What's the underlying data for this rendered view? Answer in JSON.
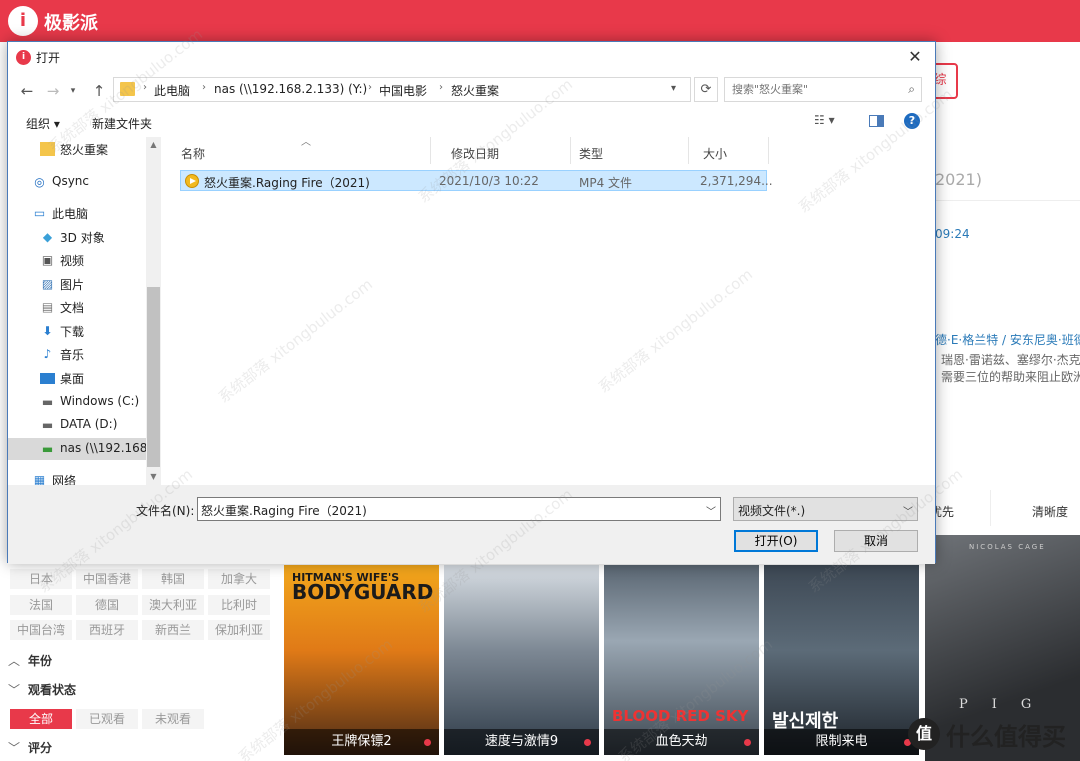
{
  "app": {
    "logo_text": "极影派",
    "search_button": "综",
    "detail": {
      "year_fragment": "2021)",
      "time_fragment": "09:24",
      "cast_fragment": "德·E·格兰特 / 安东尼奥·班德拉",
      "desc_line1": "瑞恩·雷诺兹、塞缪尔·杰克逊",
      "desc_line2": "需要三位的帮助来阻止欧洲"
    },
    "sort": {
      "priority": "优先",
      "resolution": "清晰度"
    },
    "regions": [
      "日本",
      "中国香港",
      "韩国",
      "加拿大",
      "法国",
      "德国",
      "澳大利亚",
      "比利时",
      "中国台湾",
      "西班牙",
      "新西兰",
      "保加利亚"
    ],
    "sections": {
      "year": "年份",
      "watch_status": "观看状态",
      "rating": "评分"
    },
    "watch_options": [
      "全部",
      "已观看",
      "未观看"
    ],
    "posters": [
      {
        "title": "王牌保镖2",
        "headline": "BODYGUARD",
        "subhead": "HITMAN'S WIFE'S"
      },
      {
        "title": "速度与激情9",
        "headline": "",
        "subhead": ""
      },
      {
        "title": "血色天劫",
        "headline": "BLOOD RED SKY",
        "subhead": ""
      },
      {
        "title": "限制来电",
        "headline": "발신제한",
        "subhead": ""
      }
    ],
    "right_poster": {
      "title": "PIG",
      "credit": "NICOLAS CAGE"
    },
    "brand_watermark": "什么值得买",
    "brand_mark": "值"
  },
  "dialog": {
    "title": "打开",
    "address": {
      "segments": [
        "此电脑",
        "nas (\\\\192.168.2.133) (Y:)",
        "中国电影",
        "怒火重案"
      ]
    },
    "search_placeholder": "搜索\"怒火重案\"",
    "toolbar": {
      "organize": "组织 ▾",
      "new_folder": "新建文件夹"
    },
    "nav_items": [
      {
        "label": "怒火重案",
        "icon": "folder-icon"
      },
      {
        "label": "Qsync",
        "icon": "sync-icon"
      },
      {
        "label": "此电脑",
        "icon": "computer-icon"
      },
      {
        "label": "3D 对象",
        "icon": "cube-icon"
      },
      {
        "label": "视频",
        "icon": "video-icon"
      },
      {
        "label": "图片",
        "icon": "picture-icon"
      },
      {
        "label": "文档",
        "icon": "document-icon"
      },
      {
        "label": "下载",
        "icon": "download-icon"
      },
      {
        "label": "音乐",
        "icon": "music-icon"
      },
      {
        "label": "桌面",
        "icon": "desktop-icon"
      },
      {
        "label": "Windows (C:)",
        "icon": "drive-icon"
      },
      {
        "label": "DATA (D:)",
        "icon": "drive-icon"
      },
      {
        "label": "nas (\\\\192.168.",
        "icon": "network-drive-icon"
      },
      {
        "label": "网络",
        "icon": "network-icon"
      }
    ],
    "columns": {
      "name": "名称",
      "modified": "修改日期",
      "type": "类型",
      "size": "大小"
    },
    "files": [
      {
        "name": "怒火重案.Raging Fire（2021)",
        "modified": "2021/10/3 10:22",
        "type": "MP4 文件",
        "size": "2,371,294..."
      }
    ],
    "filename_label": "文件名(N):",
    "filename_value": "怒火重案.Raging Fire（2021)",
    "filetype_value": "视频文件(*.)",
    "open_button": "打开(O)",
    "cancel_button": "取消"
  },
  "watermark_text": "系统部落 xitongbuluo.com"
}
